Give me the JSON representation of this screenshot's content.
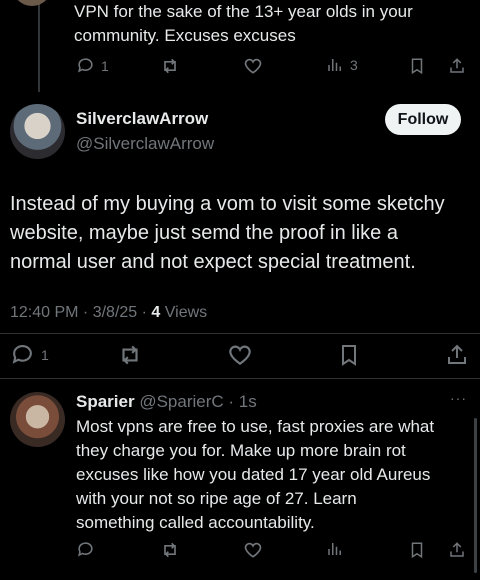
{
  "prev_reply": {
    "text_line1": "VPN for the sake of the 13+ year olds in your",
    "text_line2": "community. Excuses excuses",
    "reply_count": "1",
    "views_count": "3"
  },
  "main_post": {
    "display_name": "SilverclawArrow",
    "handle": "@SilverclawArrow",
    "follow_label": "Follow",
    "text_line1": "Instead of my buying a vom to visit some sketchy",
    "text_line2": "website, maybe just semd the proof in like a",
    "text_line3": "normal user and not expect special treatment.",
    "timestamp": "12:40 PM · 3/8/25 · ",
    "views_number": "4",
    "views_label": " Views",
    "reply_count": "1"
  },
  "reply": {
    "display_name": "Sparier",
    "handle": "@SparierC",
    "age": "· 1s",
    "more": "···",
    "lines": [
      "Most vpns are free to use, fast proxies are what",
      "they charge you for. Make up more brain rot",
      "excuses like how you dated 17 year old Aureus",
      "with your not so ripe age of 27. Learn",
      "something called accountability."
    ]
  },
  "colors": {
    "background": "#000000",
    "text": "#e7e9ea",
    "muted": "#71767b",
    "divider": "#2f3336",
    "follow_bg": "#eff3f4"
  },
  "icons": [
    "reply-icon",
    "retweet-icon",
    "like-icon",
    "views-icon",
    "bookmark-icon",
    "share-icon"
  ]
}
